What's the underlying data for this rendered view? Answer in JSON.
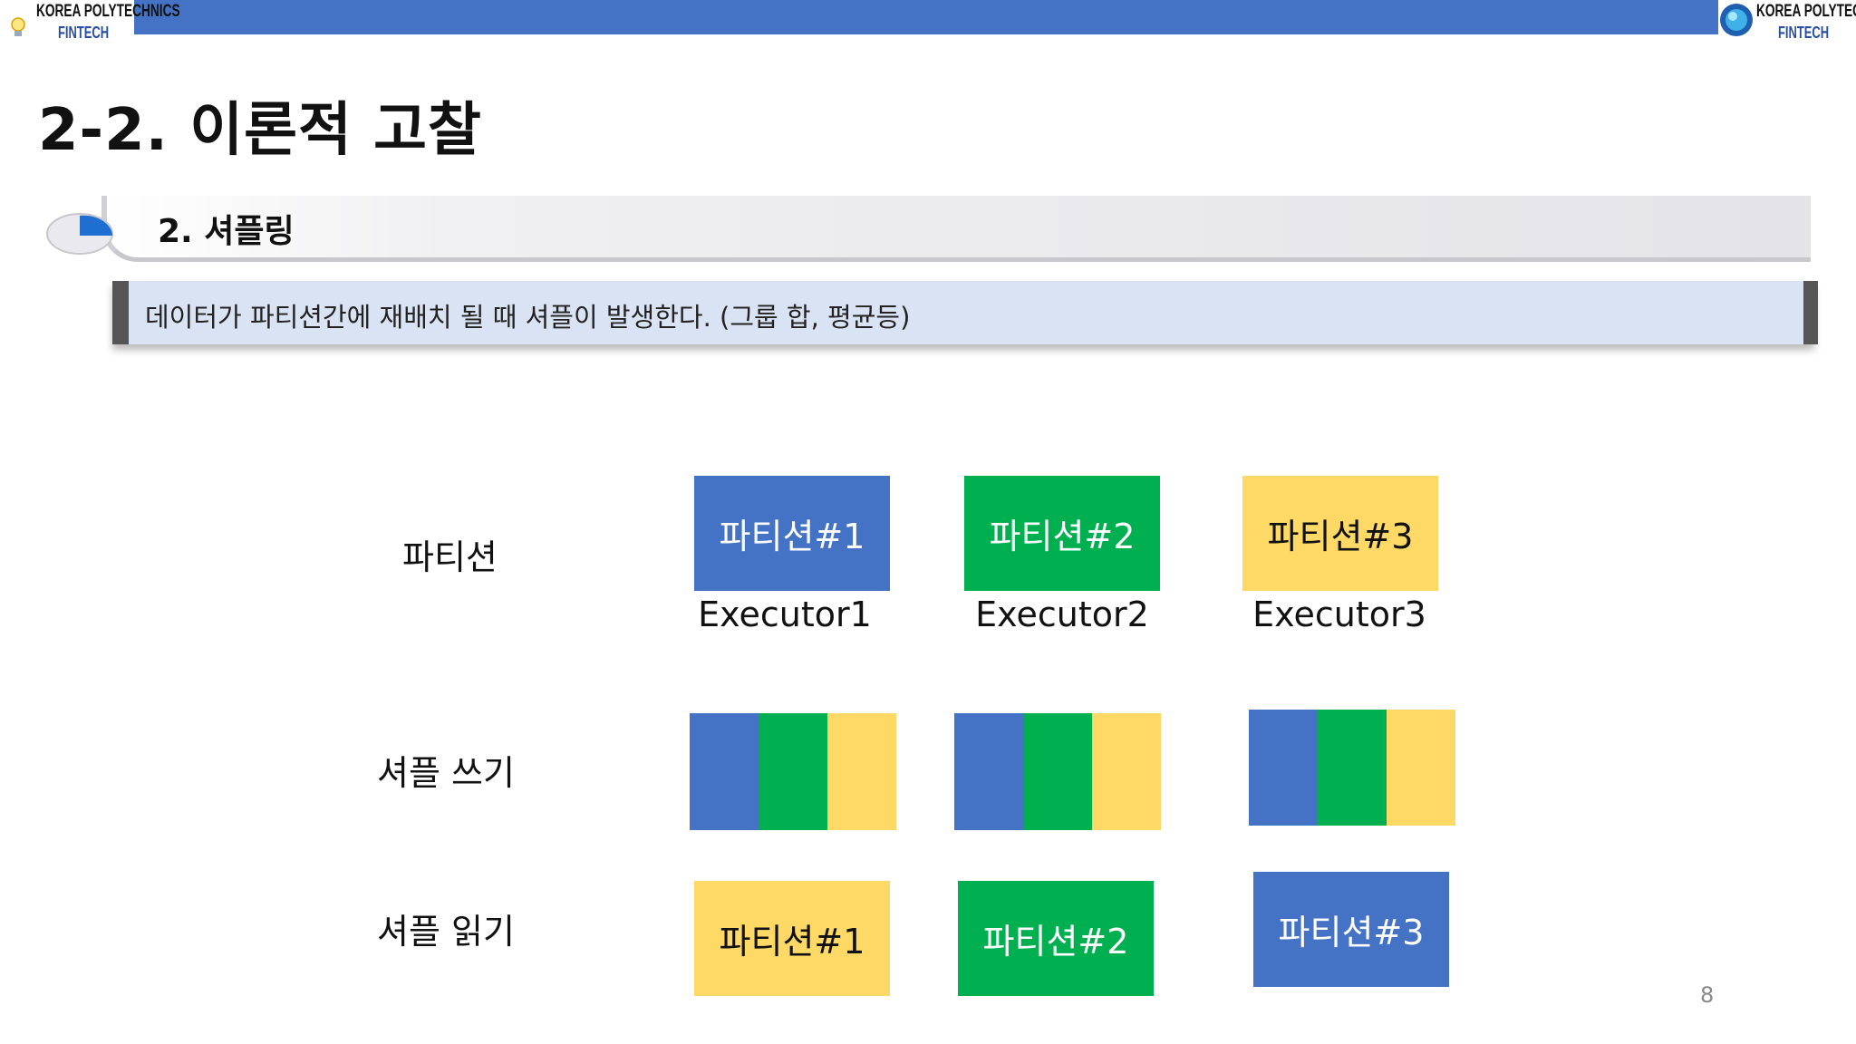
{
  "logo": {
    "line1": "KOREA POLYTECHNICS",
    "line2": "FINTECH"
  },
  "page_title": "2-2. 이론적 고찰",
  "section_title": "2. 셔플링",
  "callout_text": "데이터가 파티션간에 재배치 될 때 셔플이 발생한다. (그룹 합, 평균등)",
  "rows": {
    "partition_label": "파티션",
    "write_label": "셔플 쓰기",
    "read_label": "셔플 읽기"
  },
  "partitions": [
    {
      "label": "파티션#1",
      "executor": "Executor1",
      "color": "#4472c4"
    },
    {
      "label": "파티션#2",
      "executor": "Executor2",
      "color": "#00b050"
    },
    {
      "label": "파티션#3",
      "executor": "Executor3",
      "color": "#ffd966"
    }
  ],
  "read_partitions": [
    {
      "label": "파티션#1",
      "color": "#ffd966"
    },
    {
      "label": "파티션#2",
      "color": "#00b050"
    },
    {
      "label": "파티션#3",
      "color": "#4472c4"
    }
  ],
  "colors": {
    "blue": "#4472c4",
    "green": "#00b050",
    "yellow": "#ffd966",
    "topbar": "#4472c4"
  },
  "page_number": "8"
}
